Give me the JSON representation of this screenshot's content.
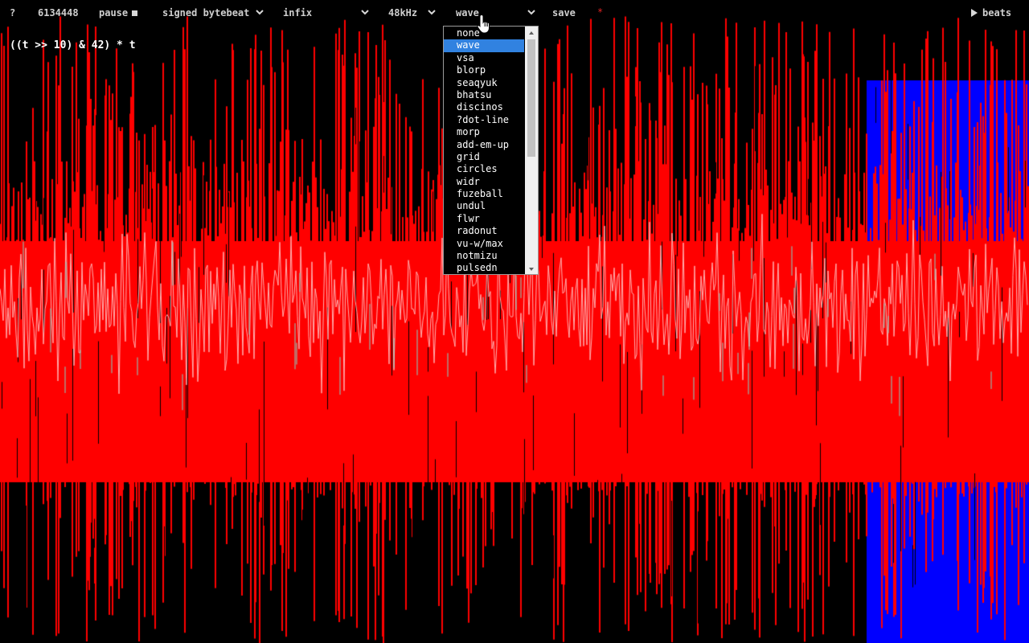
{
  "toolbar": {
    "help_label": "?",
    "time_value": "6134448",
    "pause_label": "pause",
    "type_select": "signed bytebeat",
    "syntax_select": "infix",
    "rate_select": "48kHz",
    "viz_select": "wave",
    "save_label": "save",
    "unsaved_marker": "*",
    "beats_label": "beats"
  },
  "expression": "((t >> 10) & 42) * t",
  "viz_dropdown": {
    "options": [
      "none",
      "wave",
      "vsa",
      "blorp",
      "seaqyuk",
      "bhatsu",
      "discinos",
      "?dot-line",
      "morp",
      "add-em-up",
      "grid",
      "circles",
      "widr",
      "fuzeball",
      "undul",
      "flwr",
      "radonut",
      "vu-w/max",
      "notmizu",
      "pulsedn"
    ],
    "selected": "wave"
  },
  "colors": {
    "waveform": "#ff0000",
    "highlight": "#0000ff",
    "accent_lines": "#ffb0b0",
    "accent_cyan": "#80d8c8",
    "selection": "#3182e0"
  },
  "icons": [
    "stop-icon",
    "play-icon",
    "chevron-down-icon",
    "mouse-pointer-icon"
  ]
}
